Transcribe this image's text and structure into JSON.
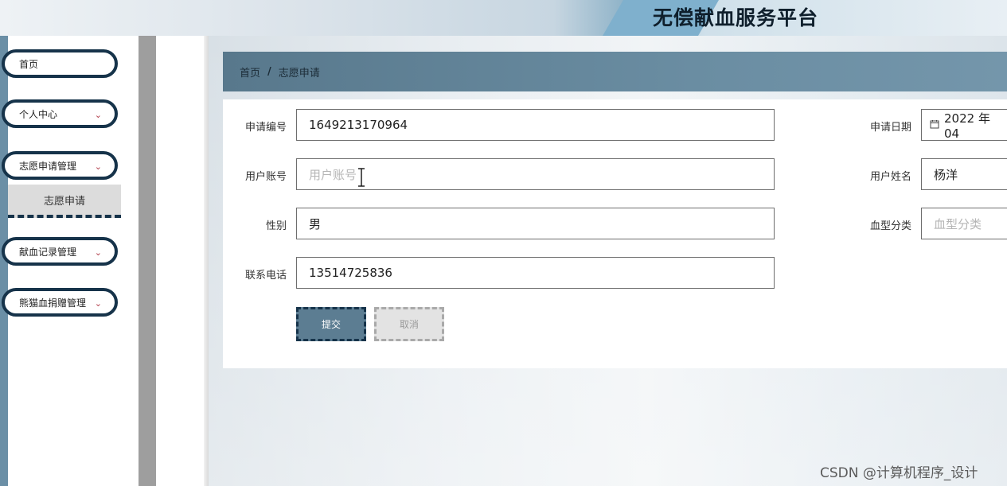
{
  "header": {
    "title": "无偿献血服务平台"
  },
  "sidebar": {
    "items": [
      {
        "label": "首页",
        "has_chevron": false
      },
      {
        "label": "个人中心",
        "has_chevron": true
      },
      {
        "label": "志愿申请管理",
        "has_chevron": true
      },
      {
        "label": "献血记录管理",
        "has_chevron": true
      },
      {
        "label": "熊猫血捐赠管理",
        "has_chevron": true
      }
    ],
    "chevron": "⌄",
    "submenu": {
      "label": "志愿申请"
    }
  },
  "breadcrumb": {
    "home": "首页",
    "separator": "/",
    "current": "志愿申请"
  },
  "form": {
    "application_no": {
      "label": "申请编号",
      "value": "1649213170964"
    },
    "apply_date": {
      "label": "申请日期",
      "value": "2022 年 04"
    },
    "user_account": {
      "label": "用户账号",
      "placeholder": "用户账号"
    },
    "user_name": {
      "label": "用户姓名",
      "value": "杨洋"
    },
    "gender": {
      "label": "性别",
      "value": "男"
    },
    "blood_type": {
      "label": "血型分类",
      "placeholder": "血型分类"
    },
    "phone": {
      "label": "联系电话",
      "value": "13514725836"
    },
    "submit_label": "提交",
    "cancel_label": "取消"
  },
  "watermark": "CSDN @计算机程序_设计",
  "colors": {
    "accent": "#16334a",
    "breadcrumb_bg": "#5c7d92",
    "menu_chevron": "#b03a48"
  }
}
